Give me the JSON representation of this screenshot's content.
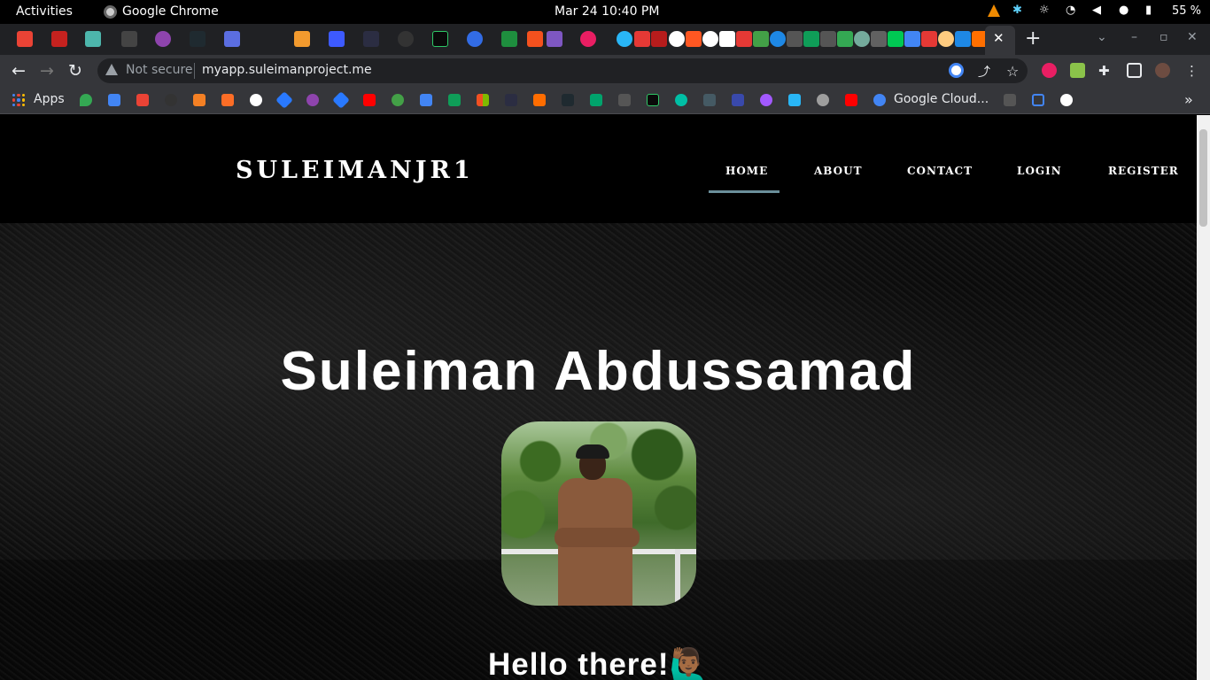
{
  "system_bar": {
    "activities": "Activities",
    "app_name": "Google Chrome",
    "datetime": "Mar 24  10:40 PM",
    "battery": "55 %"
  },
  "browser": {
    "address": {
      "security_label": "Not secure",
      "url": "myapp.suleimanproject.me"
    },
    "bookmarks": {
      "apps_label": "Apps",
      "google_cloud_label": "Google Cloud..."
    }
  },
  "site": {
    "brand": "SULEIMANJR1",
    "nav": {
      "home": "HOME",
      "about": "ABOUT",
      "contact": "CONTACT",
      "login": "LOGIN",
      "register": "REGISTER"
    },
    "nav_active_color": "#6a8e9a",
    "hero_title": "Suleiman Abdussamad",
    "greeting": "Hello there!",
    "greeting_emoji": "🙋🏾‍♂️"
  }
}
